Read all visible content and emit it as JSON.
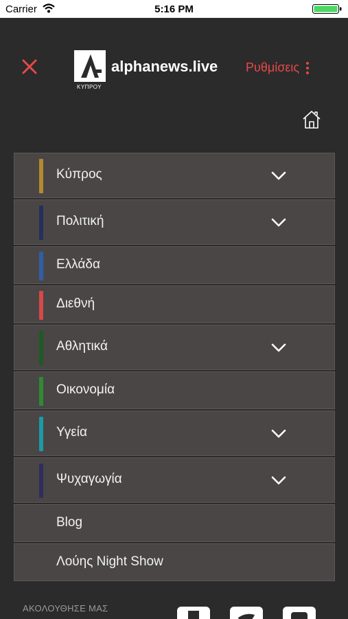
{
  "status_bar": {
    "carrier": "Carrier",
    "time": "5:16 PM"
  },
  "header": {
    "logo_text": "alphanews.live",
    "logo_sub": "ΚΥΠΡΟΥ",
    "settings_label": "Ρυθμίσεις"
  },
  "menu": {
    "items": [
      {
        "label": "Κύπρος",
        "color": "#b38a30",
        "expandable": true
      },
      {
        "label": "Πολιτική",
        "color": "#26305a",
        "expandable": true
      },
      {
        "label": "Ελλάδα",
        "color": "#2f5fa6",
        "expandable": false
      },
      {
        "label": "Διεθνή",
        "color": "#d94848",
        "expandable": false
      },
      {
        "label": "Αθλητικά",
        "color": "#1f5a24",
        "expandable": true
      },
      {
        "label": "Οικονομία",
        "color": "#2f8a34",
        "expandable": false
      },
      {
        "label": "Υγεία",
        "color": "#1c9aa6",
        "expandable": true
      },
      {
        "label": "Ψυχαγωγία",
        "color": "#2f2e5c",
        "expandable": true
      },
      {
        "label": "Blog",
        "color": "",
        "expandable": false
      },
      {
        "label": "Λούης Night Show",
        "color": "",
        "expandable": false
      }
    ]
  },
  "footer": {
    "follow_label": "ΑΚΟΛΟΥΘΗΣΕ ΜΑΣ",
    "social": [
      "facebook-icon",
      "twitter-icon",
      "youtube-icon"
    ]
  },
  "colors": {
    "accent": "#e84848",
    "background": "#2b2b2b",
    "item_bg": "#4a4646"
  }
}
